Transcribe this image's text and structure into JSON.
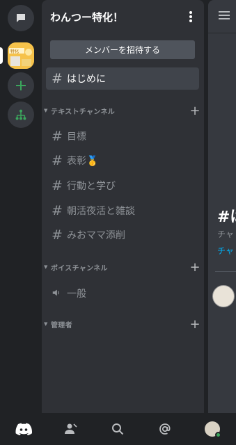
{
  "server": {
    "name": "わんつー特化！",
    "invite_label": "メンバーを招待する",
    "logo_text": "特化"
  },
  "channels_top": [
    {
      "name": "はじめに",
      "active": true
    }
  ],
  "categories": [
    {
      "name": "テキストチャンネル",
      "channels": [
        {
          "name": "目標",
          "icon": "hash-icon"
        },
        {
          "name": "表彰🥇",
          "icon": "hash-icon"
        },
        {
          "name": "行動と学び",
          "icon": "hash-icon"
        },
        {
          "name": "朝活夜活と雑談",
          "icon": "hash-icon"
        },
        {
          "name": "みおママ添削",
          "icon": "hash-icon"
        }
      ]
    },
    {
      "name": "ボイスチャンネル",
      "channels": [
        {
          "name": "一般",
          "icon": "speaker-icon"
        }
      ]
    },
    {
      "name": "管理者",
      "channels": []
    }
  ],
  "right_pane": {
    "heading": "#は",
    "subtitle": "チャ",
    "link": "チャ"
  },
  "colors": {
    "rail_bg": "#202225",
    "panel_bg": "#2f3136",
    "active_channel": "#40444b",
    "add_green": "#3ba55c",
    "link_blue": "#00aff4",
    "brand": "#5865f2"
  }
}
